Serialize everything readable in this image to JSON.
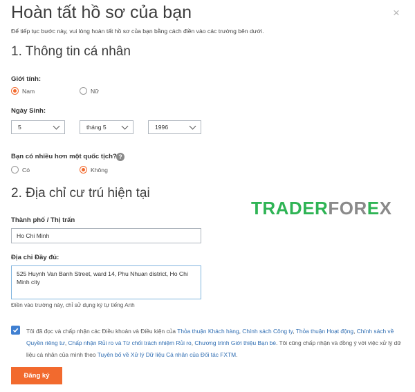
{
  "header": {
    "title": "Hoàn tất hồ sơ của bạn",
    "subtitle": "Để tiếp tục bước này, vui lòng hoàn tất hồ sơ của bạn bằng cách điền vào các trường bên dưới.",
    "close_symbol": "×"
  },
  "section1": {
    "heading": "1. Thông tin cá nhân",
    "gender": {
      "label": "Giới tính:",
      "options": [
        {
          "label": "Nam",
          "selected": true
        },
        {
          "label": "Nữ",
          "selected": false
        }
      ]
    },
    "birthday": {
      "label": "Ngày Sinh:",
      "day": "5",
      "month": "tháng 5",
      "year": "1996"
    },
    "nationality": {
      "label": "Bạn có nhiều hơn một quốc tịch?",
      "info_symbol": "?",
      "options": [
        {
          "label": "Có",
          "selected": false
        },
        {
          "label": "Không",
          "selected": true
        }
      ]
    }
  },
  "section2": {
    "heading": "2. Địa chỉ cư trú hiện tại",
    "city": {
      "label": "Thành phố / Thị trấn",
      "value": "Ho Chi Minh"
    },
    "address": {
      "label": "Địa chỉ Đầy đủ:",
      "value": "525 Huynh Van Banh Street, ward 14, Phu Nhuan district, Ho Chi Minh city",
      "hint": "Điền vào trường này, chỉ sử dụng ký tự tiếng Anh"
    }
  },
  "terms": {
    "checked": true,
    "text_1": "Tôi đã đọc và chấp nhận các Điều khoản và Điều kiện của ",
    "link_1": "Thỏa thuận Khách hàng",
    "sep_1": ", ",
    "link_2": "Chính sách Công ty",
    "sep_2": ", ",
    "link_3": "Thỏa thuận Hoạt động",
    "sep_3": ", ",
    "link_4": "Chính sách về Quyền riêng tư",
    "sep_4": ", ",
    "link_5": "Chấp nhận Rủi ro và Từ chối trách nhiệm Rủi ro",
    "sep_5": ", ",
    "link_6": "Chương trình Giới thiệu Bạn bè",
    "text_2": ". Tôi cũng chấp nhận và đồng ý với việc xử lý dữ liệu cá nhân của mình theo ",
    "link_7": "Tuyên bố về Xử lý Dữ liệu Cá nhân của Đối tác FXTM",
    "text_3": "."
  },
  "submit_label": "Đăng ký",
  "watermark": {
    "part1": "TRADER",
    "part2": "FOR",
    "part3": "E",
    "part4": "X"
  },
  "colors": {
    "accent": "#f26a2e",
    "link": "#2f6db2",
    "checkbox": "#3f7fd1",
    "watermark_green": "#2fb455"
  }
}
